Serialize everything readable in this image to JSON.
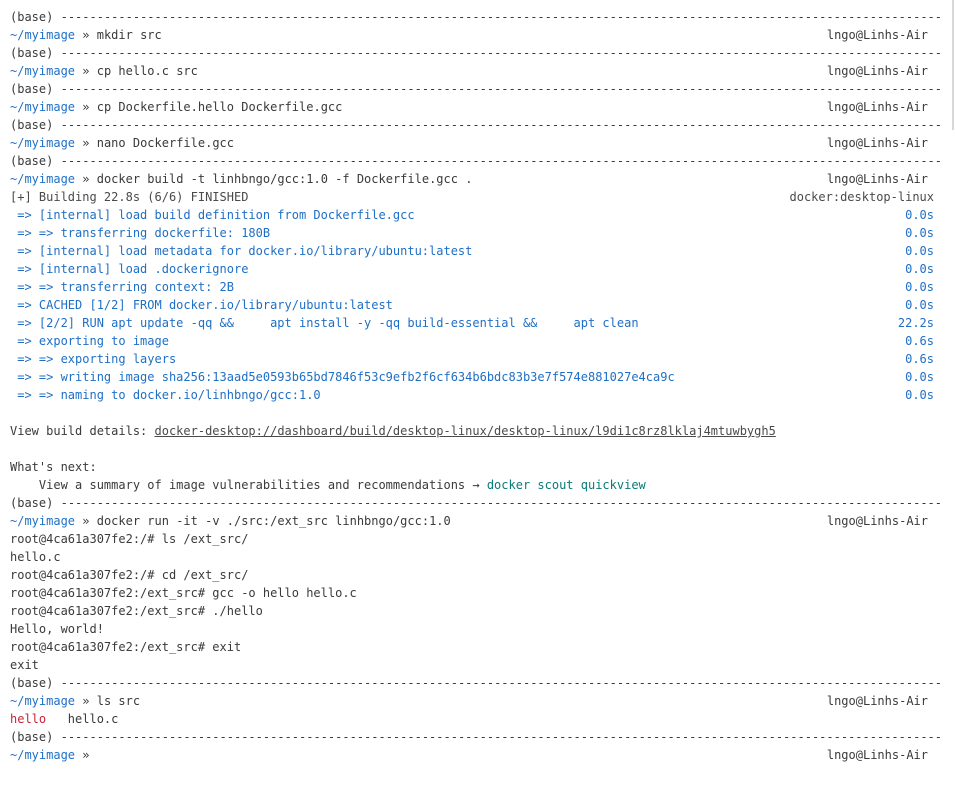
{
  "terminal": {
    "prompt_path": "~/myimage",
    "prompt_symbol": "»",
    "host": "lngo@Linhs-Air",
    "base_label": "(base)",
    "separator": "-------------------------------------------------------------------------------------------------------------------------------------------------------"
  },
  "commands": {
    "c1": "mkdir src",
    "c2": "cp hello.c src",
    "c3": "cp Dockerfile.hello Dockerfile.gcc",
    "c4": "nano Dockerfile.gcc",
    "c5": "docker build -t linhbngo/gcc:1.0 -f Dockerfile.gcc .",
    "c6": "docker run -it -v ./src:/ext_src linhbngo/gcc:1.0",
    "c7": "ls src"
  },
  "build": {
    "header": "[+] Building 22.8s (6/6) FINISHED",
    "platform": "docker:desktop-linux",
    "steps": [
      {
        "text": " => [internal] load build definition from Dockerfile.gcc",
        "time": "0.0s"
      },
      {
        "text": " => => transferring dockerfile: 180B",
        "time": "0.0s"
      },
      {
        "text": " => [internal] load metadata for docker.io/library/ubuntu:latest",
        "time": "0.0s"
      },
      {
        "text": " => [internal] load .dockerignore",
        "time": "0.0s"
      },
      {
        "text": " => => transferring context: 2B",
        "time": "0.0s"
      },
      {
        "text": " => CACHED [1/2] FROM docker.io/library/ubuntu:latest",
        "time": "0.0s"
      },
      {
        "text": " => [2/2] RUN apt update -qq &&     apt install -y -qq build-essential &&     apt clean",
        "time": "22.2s"
      },
      {
        "text": " => exporting to image",
        "time": "0.6s"
      },
      {
        "text": " => => exporting layers",
        "time": "0.6s"
      },
      {
        "text": " => => writing image sha256:13aad5e0593b65bd7846f53c9efb2f6cf634b6bdc83b3e7f574e881027e4ca9c",
        "time": "0.0s"
      },
      {
        "text": " => => naming to docker.io/linhbngo/gcc:1.0",
        "time": "0.0s"
      }
    ],
    "details_label": "View build details: ",
    "details_link": "docker-desktop://dashboard/build/desktop-linux/desktop-linux/l9di1c8rz8lklaj4mtuwbygh5",
    "whats_next": "What's next:",
    "next_text": "    View a summary of image vulnerabilities and recommendations → ",
    "next_cmd": "docker scout quickview"
  },
  "session": {
    "l1": "root@4ca61a307fe2:/# ls /ext_src/",
    "l2": "hello.c",
    "l3": "root@4ca61a307fe2:/# cd /ext_src/",
    "l4": "root@4ca61a307fe2:/ext_src# gcc -o hello hello.c",
    "l5": "root@4ca61a307fe2:/ext_src# ./hello",
    "l6": "Hello, world!",
    "l7": "root@4ca61a307fe2:/ext_src# exit",
    "l8": "exit"
  },
  "ls_output": {
    "exe": "hello",
    "file": "   hello.c"
  },
  "colors": {
    "prompt": "#1f6fc5",
    "build_step": "#1f6fc5",
    "teal": "#0a7a7a",
    "executable": "#c7243a"
  }
}
